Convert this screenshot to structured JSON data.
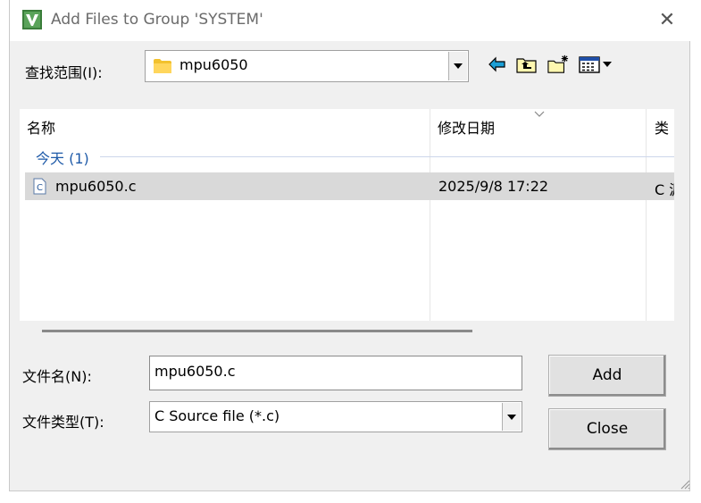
{
  "window": {
    "title": "Add Files to Group 'SYSTEM'",
    "close_glyph": "✕"
  },
  "lookin": {
    "label": "查找范围(I):",
    "value": "mpu6050",
    "folder_icon_color": "#f2c12e"
  },
  "toolbar": {
    "icons": [
      "back-arrow-icon",
      "up-folder-icon",
      "new-folder-icon",
      "view-menu-icon"
    ]
  },
  "file_list": {
    "columns": [
      "名称",
      "修改日期",
      "类"
    ],
    "group": "今天 (1)",
    "files": [
      {
        "name": "mpu6050.c",
        "modified": "2025/9/8 17:22",
        "type": "C 源"
      }
    ]
  },
  "filename": {
    "label": "文件名(N):",
    "value": "mpu6050.c"
  },
  "filetype": {
    "label": "文件类型(T):",
    "value": "C Source file (*.c)"
  },
  "buttons": {
    "add": "Add",
    "close": "Close"
  },
  "colors": {
    "dialog_bg": "#f0f0f0",
    "selection": "#d9d9d9",
    "group_text": "#1e5aa8",
    "back_arrow": "#1a9fd6"
  }
}
